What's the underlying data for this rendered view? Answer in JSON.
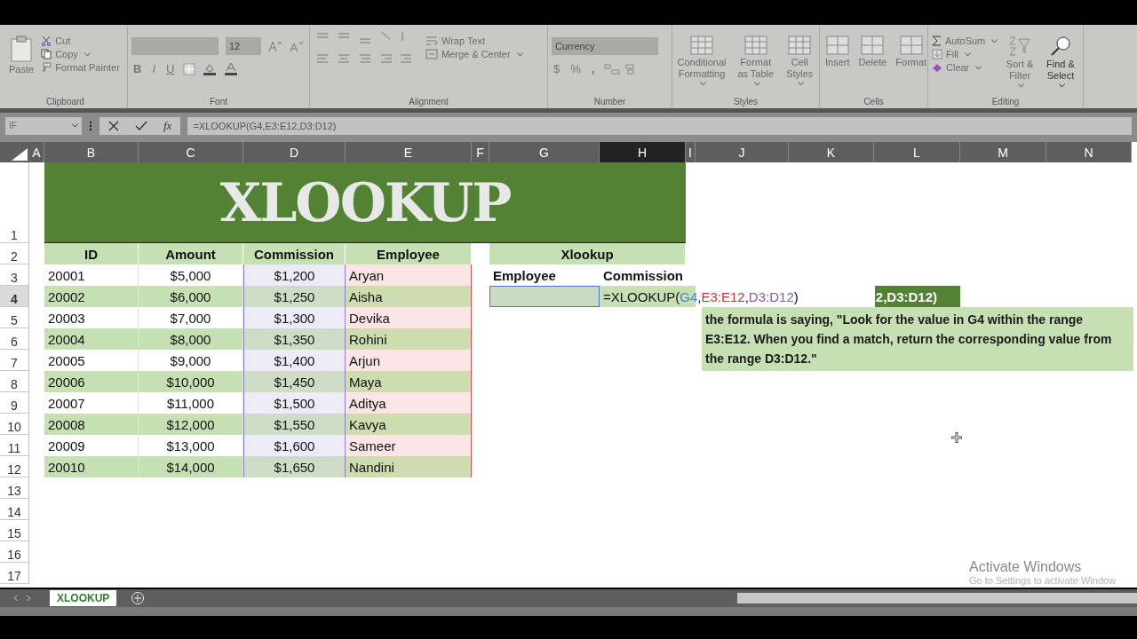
{
  "ribbon": {
    "clipboard": {
      "label": "Clipboard",
      "paste": "Paste",
      "cut": "Cut",
      "copy": "Copy",
      "format_painter": "Format Painter"
    },
    "font": {
      "label": "Font",
      "font_size": "12",
      "bold": "B",
      "italic": "I",
      "underline": "U"
    },
    "alignment": {
      "label": "Alignment",
      "wrap_text": "Wrap Text",
      "merge": "Merge & Center"
    },
    "number": {
      "label": "Number",
      "format": "Currency",
      "currency": "$",
      "percent": "%",
      "comma": ","
    },
    "styles": {
      "label": "Styles",
      "items": [
        "Conditional Formatting",
        "Format as Table",
        "Cell Styles"
      ]
    },
    "cells": {
      "label": "Cells",
      "items": [
        "Insert",
        "Delete",
        "Format"
      ]
    },
    "editing": {
      "label": "Editing",
      "autosum": "AutoSum",
      "fill": "Fill",
      "clear": "Clear",
      "sort": "Sort & Filter",
      "find": "Find & Select"
    }
  },
  "formula_bar": {
    "name_box": "IF",
    "fx": "fx",
    "formula": "=XLOOKUP(G4,E3:E12,D3:D12)"
  },
  "columns": [
    {
      "label": "A",
      "selected": false
    },
    {
      "label": "B",
      "selected": false
    },
    {
      "label": "C",
      "selected": false
    },
    {
      "label": "D",
      "selected": false
    },
    {
      "label": "E",
      "selected": false
    },
    {
      "label": "F",
      "selected": false
    },
    {
      "label": "G",
      "selected": false
    },
    {
      "label": "H",
      "selected": true
    },
    {
      "label": "I",
      "selected": false
    },
    {
      "label": "J",
      "selected": false
    },
    {
      "label": "K",
      "selected": false
    },
    {
      "label": "L",
      "selected": false
    },
    {
      "label": "M",
      "selected": false
    },
    {
      "label": "N",
      "selected": false
    }
  ],
  "rows": [
    {
      "label": "1",
      "selected": false
    },
    {
      "label": "2",
      "selected": false
    },
    {
      "label": "3",
      "selected": false
    },
    {
      "label": "4",
      "selected": true
    },
    {
      "label": "5",
      "selected": false
    },
    {
      "label": "6",
      "selected": false
    },
    {
      "label": "7",
      "selected": false
    },
    {
      "label": "8",
      "selected": false
    },
    {
      "label": "9",
      "selected": false
    },
    {
      "label": "10",
      "selected": false
    },
    {
      "label": "11",
      "selected": false
    },
    {
      "label": "12",
      "selected": false
    },
    {
      "label": "13",
      "selected": false
    },
    {
      "label": "14",
      "selected": false
    },
    {
      "label": "15",
      "selected": false
    },
    {
      "label": "16",
      "selected": false
    },
    {
      "label": "17",
      "selected": false
    }
  ],
  "title": "XLOOKUP",
  "table": {
    "columns": [
      "ID",
      "Amount",
      "Commission",
      "Employee"
    ],
    "rows": [
      [
        "20001",
        "$5,000",
        "$1,200",
        "Aryan"
      ],
      [
        "20002",
        "$6,000",
        "$1,250",
        "Aisha"
      ],
      [
        "20003",
        "$7,000",
        "$1,300",
        "Devika"
      ],
      [
        "20004",
        "$8,000",
        "$1,350",
        "Rohini"
      ],
      [
        "20005",
        "$9,000",
        "$1,400",
        "Arjun"
      ],
      [
        "20006",
        "$10,000",
        "$1,450",
        "Maya"
      ],
      [
        "20007",
        "$11,000",
        "$1,500",
        "Aditya"
      ],
      [
        "20008",
        "$12,000",
        "$1,550",
        "Kavya"
      ],
      [
        "20009",
        "$13,000",
        "$1,600",
        "Sameer"
      ],
      [
        "20010",
        "$14,000",
        "$1,650",
        "Nandini"
      ]
    ]
  },
  "lookup": {
    "title": "Xlookup",
    "columns": [
      "Employee",
      "Commission"
    ],
    "formula_parts": [
      {
        "text": "=XLOOKUP("
      },
      {
        "text": "G4",
        "color": "#4a86c5"
      },
      {
        "text": ","
      },
      {
        "text": "E3:E12",
        "color": "#c0392b"
      },
      {
        "text": ","
      },
      {
        "text": "D3:D12",
        "color": "#7a5ea8"
      },
      {
        "text": ")"
      }
    ]
  },
  "formula_badge": "2,D3:D12)",
  "explanation": "the formula is saying, \"Look for the value in G4 within the range E3:E12. When you find a match, return the corresponding value from the range D3:D12.\"",
  "sheet_tabs": [
    {
      "label": "XLOOKUP",
      "selected": true
    }
  ],
  "activation": {
    "title": "Activate Windows",
    "hint": "Go to Settings to activate Window"
  }
}
